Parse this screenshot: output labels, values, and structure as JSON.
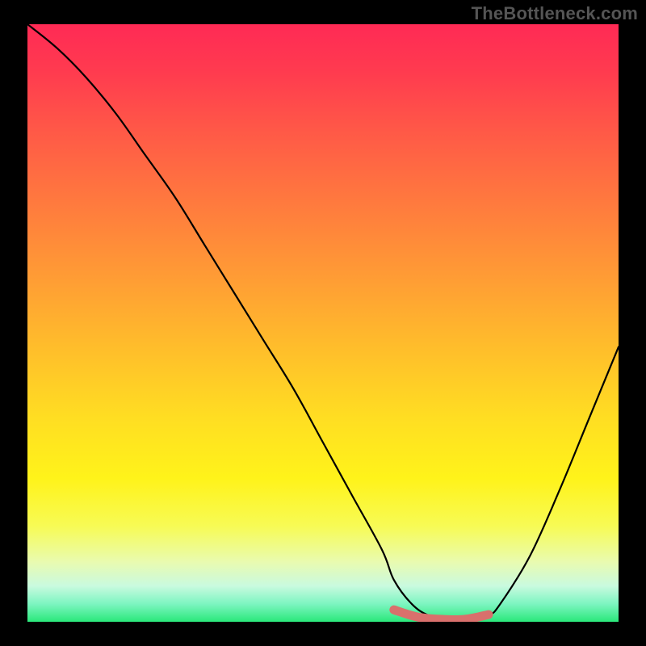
{
  "watermark": "TheBottleneck.com",
  "chart_data": {
    "type": "line",
    "title": "",
    "xlabel": "",
    "ylabel": "",
    "xlim": [
      0,
      100
    ],
    "ylim": [
      0,
      100
    ],
    "series": [
      {
        "name": "bottleneck-curve",
        "x": [
          0,
          5,
          10,
          15,
          20,
          25,
          30,
          35,
          40,
          45,
          50,
          55,
          60,
          62,
          65,
          68,
          72,
          75,
          78,
          80,
          85,
          90,
          95,
          100
        ],
        "values": [
          100,
          96,
          91,
          85,
          78,
          71,
          63,
          55,
          47,
          39,
          30,
          21,
          12,
          7,
          3,
          1,
          0,
          0,
          1,
          3,
          11,
          22,
          34,
          46
        ]
      },
      {
        "name": "optimal-band",
        "x": [
          62,
          66,
          70,
          74,
          78
        ],
        "values": [
          2,
          0.8,
          0.4,
          0.4,
          1.2
        ]
      }
    ],
    "gradient_colors": {
      "top": "#ff2a55",
      "mid": "#ffde22",
      "bottom": "#2ae87a"
    },
    "marker_color": "#d9706c"
  }
}
